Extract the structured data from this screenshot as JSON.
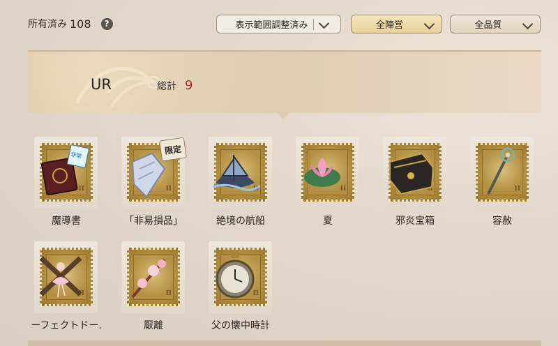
{
  "header": {
    "owned_label": "所有済み",
    "owned_count": "108",
    "help_icon": "?",
    "filters": {
      "range": "表示範囲調整済み",
      "camp": "全陣営",
      "quality": "全品質"
    }
  },
  "section": {
    "rarity": "UR",
    "total_label": "総計",
    "total_count": "9"
  },
  "items": [
    {
      "name": "魔導書",
      "icon": "grimoire-icon"
    },
    {
      "name": "「非易損品」",
      "icon": "fragile-parcel-icon",
      "badge": "限定"
    },
    {
      "name": "絶境の航船",
      "icon": "sailing-ship-icon"
    },
    {
      "name": "夏",
      "icon": "lotus-flower-icon"
    },
    {
      "name": "邪炎宝箱",
      "icon": "dark-treasure-chest-icon"
    },
    {
      "name": "容赦",
      "icon": "ornate-scepter-icon"
    },
    {
      "name": "ーフェクトドー.",
      "icon": "ballerina-doll-icon"
    },
    {
      "name": "厭離",
      "icon": "blossom-branch-icon"
    },
    {
      "name": "父の懐中時計",
      "icon": "pocket-watch-icon"
    }
  ],
  "colors": {
    "accent_red": "#b02a22",
    "stamp_gold": "#b48f3e",
    "camp_dropdown": "#e9d19a"
  }
}
